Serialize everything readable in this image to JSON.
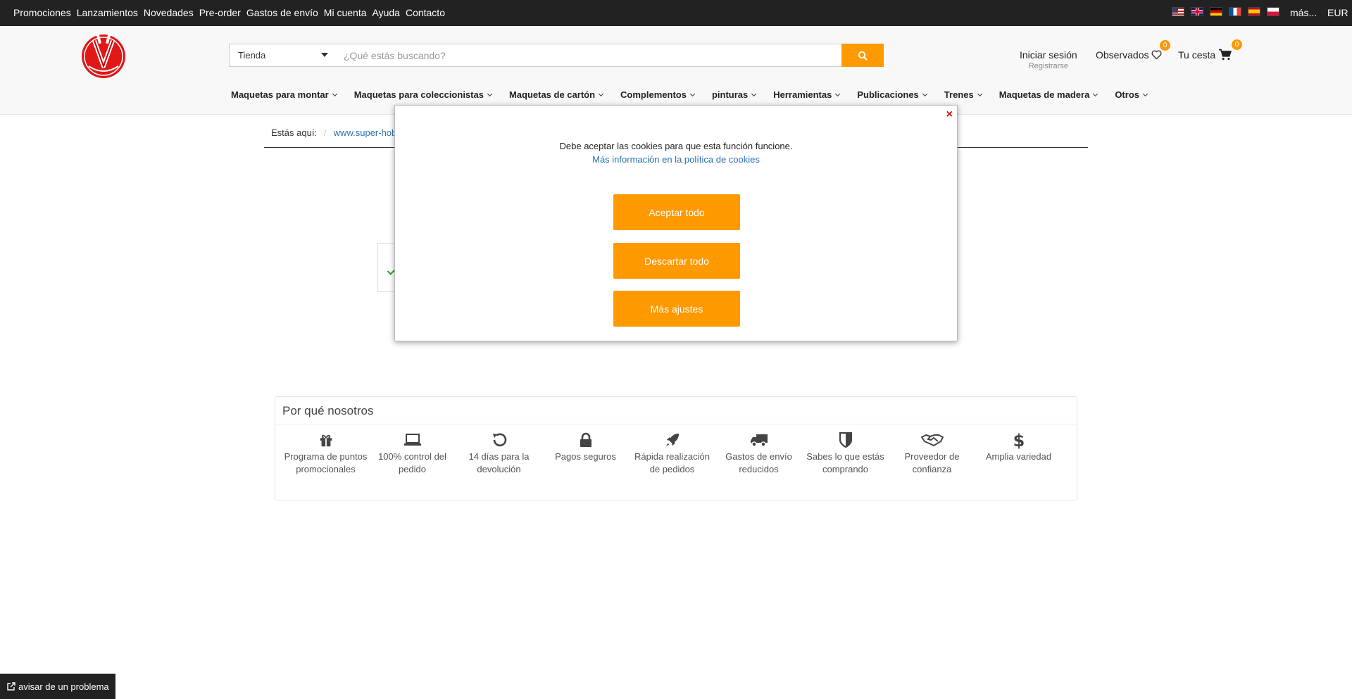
{
  "topbar": {
    "links": [
      "Promociones",
      "Lanzamientos",
      "Novedades",
      "Pre-order",
      "Gastos de envío",
      "Mi cuenta",
      "Ayuda",
      "Contacto"
    ],
    "flags": [
      "flag-us-icon",
      "flag-gb-icon",
      "flag-de-icon",
      "flag-fr-icon",
      "flag-es-icon",
      "flag-pl-icon"
    ],
    "more": "más...",
    "currency": "EUR"
  },
  "search": {
    "category": "Tienda",
    "placeholder": "¿Qué estás buscando?",
    "button_icon": "search-icon"
  },
  "account": {
    "login": "Iniciar sesión",
    "register": "Registrarse",
    "watch_label": "Observados",
    "watch_count": "0",
    "cart_label": "Tu cesta",
    "cart_count": "0"
  },
  "nav": {
    "items": [
      "Maquetas para montar",
      "Maquetas para coleccionistas",
      "Maquetas de cartón",
      "Complementos",
      "pinturas",
      "Herramientas",
      "Publicaciones",
      "Trenes",
      "Maquetas de madera",
      "Otros"
    ]
  },
  "breadcrumb": {
    "label": "Estás aquí:",
    "sep": "/",
    "link": "www.super-hob"
  },
  "modal": {
    "message": "Debe aceptar las cookies para que esta función funcione.",
    "info_link": "Más información en la política de cookies",
    "accept": "Aceptar todo",
    "reject": "Descartar todo",
    "settings": "Más ajustes",
    "close": "×"
  },
  "why": {
    "title": "Por qué nosotros",
    "features": [
      {
        "icon": "gift-icon",
        "label": "Programa de puntos promocionales"
      },
      {
        "icon": "laptop-icon",
        "label": "100% control del pedido"
      },
      {
        "icon": "undo-icon",
        "label": "14 días para la devolución"
      },
      {
        "icon": "lock-icon",
        "label": "Pagos seguros"
      },
      {
        "icon": "rocket-icon",
        "label": "Rápida realización de pedidos"
      },
      {
        "icon": "truck-icon",
        "label": "Gastos de envío reducidos"
      },
      {
        "icon": "shield-icon",
        "label": "Sabes lo que estás comprando"
      },
      {
        "icon": "handshake-icon",
        "label": "Proveedor de confianza"
      },
      {
        "icon": "dollar-icon",
        "label": "Amplia variedad"
      }
    ]
  },
  "report": {
    "label": "avisar de un problema"
  },
  "colors": {
    "accent": "#ff9900",
    "topbar": "#222222",
    "link": "#2a70b0"
  }
}
